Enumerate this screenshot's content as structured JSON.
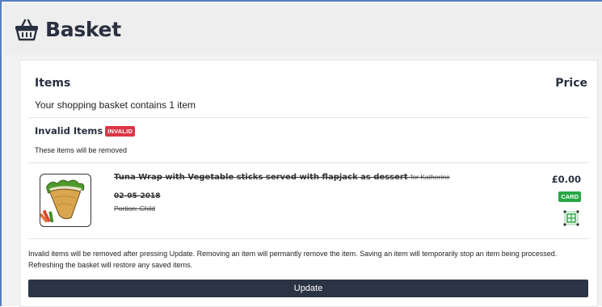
{
  "header": {
    "title": "Basket",
    "icon": "basket-icon"
  },
  "basket": {
    "items_title": "Items",
    "price_title": "Price",
    "summary": "Your shopping basket contains 1 item",
    "invalid_section": {
      "title": "Invalid Items",
      "badge": "INVALID",
      "note": "These items will be removed",
      "badge_color": "#dc3545"
    },
    "items": [
      {
        "name": "Tuna Wrap with Vegetable sticks served with flapjack as dessert",
        "for": "for Katherine",
        "date": "02-05-2018",
        "portion": "Portion: Child",
        "price": "£0.00",
        "payment_badge": "CARD",
        "payment_badge_color": "#28a745",
        "image": "tuna-wrap-image",
        "action_icon": "save-item-icon"
      }
    ],
    "footer_note": "Invalid items will be removed after pressing Update. Removing an item will permantly remove the item. Saving an item will temporarily stop an item being processed. Refreshing the basket will restore any saved items.",
    "update_label": "Update"
  },
  "colors": {
    "header_text": "#2a3040",
    "button_bg": "#2b3444"
  }
}
